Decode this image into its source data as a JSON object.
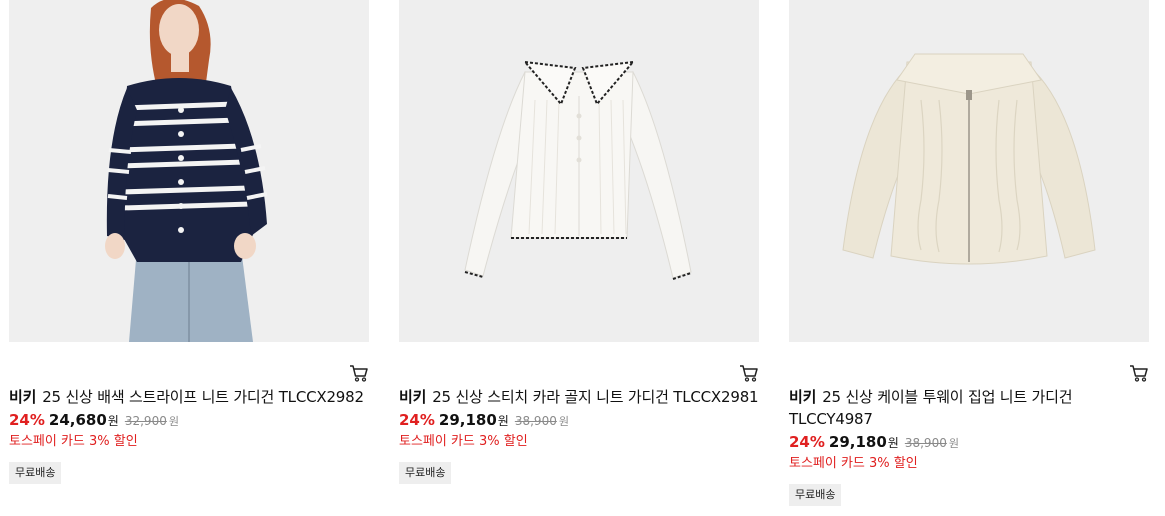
{
  "products": [
    {
      "brand": "비키",
      "title": "25 신상 배색 스트라이프 니트 가디건 TLCCX2982",
      "discount": "24%",
      "price": "24,680",
      "currency": "원",
      "original_price": "32,900",
      "promo": "토스페이 카드 3% 할인",
      "shipping": "무료배송"
    },
    {
      "brand": "비키",
      "title": "25 신상 스티치 카라 골지 니트 가디건 TLCCX2981",
      "discount": "24%",
      "price": "29,180",
      "currency": "원",
      "original_price": "38,900",
      "promo": "토스페이 카드 3% 할인",
      "shipping": "무료배송"
    },
    {
      "brand": "비키",
      "title": "25 신상 케이블 투웨이 집업 니트 가디건 TLCCY4987",
      "discount": "24%",
      "price": "29,180",
      "currency": "원",
      "original_price": "38,900",
      "promo": "토스페이 카드 3% 할인",
      "shipping": "무료배송"
    }
  ],
  "icons": {
    "cart": "cart-icon"
  },
  "colors": {
    "discount": "#e02020",
    "thumb_bg": "#eeeeee",
    "strike": "#8a8a8a"
  }
}
